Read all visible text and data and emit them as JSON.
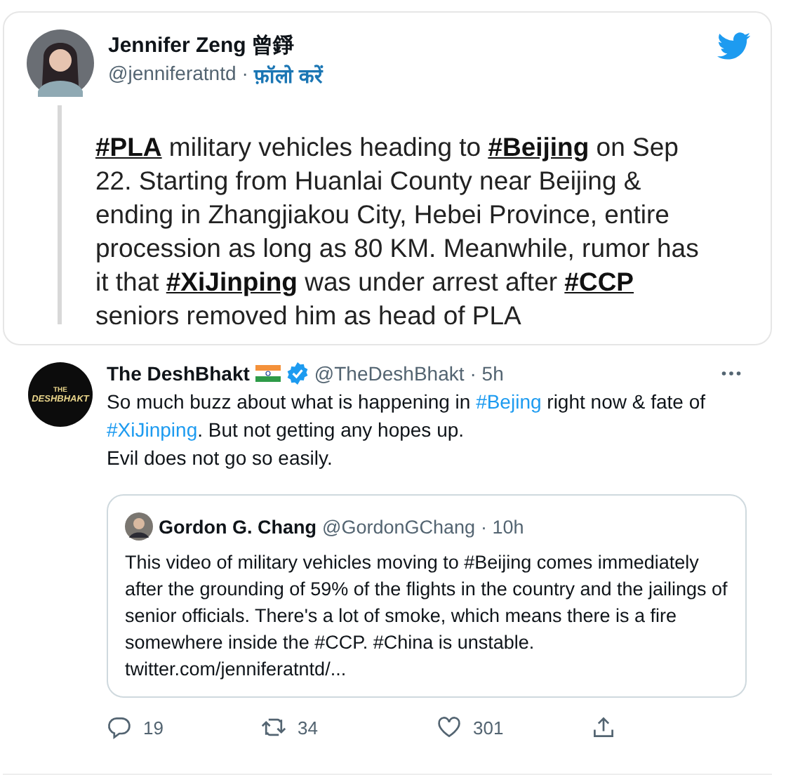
{
  "embedded_tweet": {
    "author": {
      "name": "Jennifer Zeng 曾錚",
      "handle": "@jenniferatntd",
      "separator": "·",
      "follow": "फ़ॉलो करें"
    },
    "text": [
      {
        "kind": "tag",
        "text": "#PLA"
      },
      {
        "kind": "plain",
        "text": " military vehicles heading to "
      },
      {
        "kind": "tag",
        "text": "#Beijing"
      },
      {
        "kind": "plain",
        "text": " on Sep 22. Starting from Huanlai County near Beijing & ending in Zhangjiakou City, Hebei Province, entire procession as long as 80 KM. Meanwhile, rumor has it that "
      },
      {
        "kind": "tag",
        "text": "#XiJinping"
      },
      {
        "kind": "plain",
        "text": " was under arrest after "
      },
      {
        "kind": "tag",
        "text": "#CCP"
      },
      {
        "kind": "plain",
        "text": " seniors removed him as head of PLA"
      }
    ]
  },
  "reply_tweet": {
    "author": {
      "name": "The DeshBhakt",
      "logo_text": [
        "THE",
        "DESHBHAKT"
      ],
      "verified": true,
      "handle": "@TheDeshBhakt",
      "time": "· 5h"
    },
    "lines": [
      [
        {
          "kind": "plain",
          "text": "So much buzz about what is happening in "
        },
        {
          "kind": "tag",
          "text": "#Bejing"
        },
        {
          "kind": "plain",
          "text": " right now & fate of"
        }
      ],
      [
        {
          "kind": "tag",
          "text": "#XiJinping"
        },
        {
          "kind": "plain",
          "text": ". But not getting any hopes up."
        }
      ],
      [
        {
          "kind": "plain",
          "text": "Evil does not go so easily."
        }
      ]
    ],
    "quote": {
      "name": "Gordon G. Chang",
      "handle": "@GordonGChang",
      "time": "· 10h",
      "text": "This video of military vehicles moving to #Beijing comes immediately after the grounding of 59% of the flights in the country and the jailings of senior officials. There's a lot of smoke, which means there is a fire somewhere inside the #CCP. #China is unstable.",
      "link": "twitter.com/jenniferatntd/..."
    },
    "actions": [
      {
        "kind": "reply",
        "count": "19"
      },
      {
        "kind": "retweet",
        "count": "34"
      },
      {
        "kind": "like",
        "count": "301"
      },
      {
        "kind": "share"
      }
    ]
  }
}
